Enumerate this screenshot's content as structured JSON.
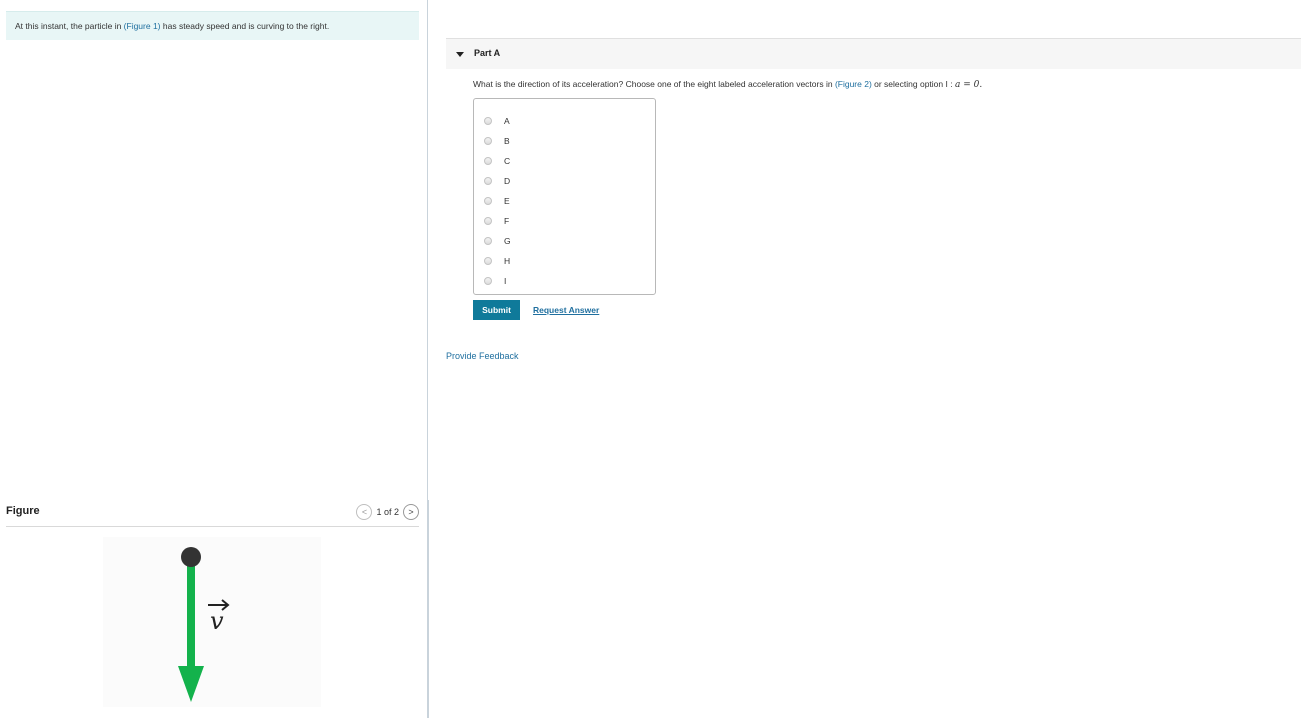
{
  "intro": {
    "before": "At this instant, the particle in ",
    "link": "(Figure 1)",
    "after": " has steady speed and is curving to the right."
  },
  "figure": {
    "title": "Figure",
    "pager": "1 of 2",
    "prev_icon": "<",
    "next_icon": ">",
    "vector_label": "v",
    "colors": {
      "arrow": "#13b24c",
      "particle": "#333333"
    }
  },
  "part": {
    "title": "Part A",
    "question_before": "What is the direction of its acceleration? Choose one of the eight labeled acceleration vectors in ",
    "question_link": "(Figure 2)",
    "question_after": " or selecting option I : ",
    "math_lhs": "a",
    "math_eq": " = ",
    "math_rhs": "0",
    "math_end": ".",
    "options": [
      "A",
      "B",
      "C",
      "D",
      "E",
      "F",
      "G",
      "H",
      "I"
    ],
    "submit": "Submit",
    "request_answer": "Request Answer"
  },
  "feedback": "Provide Feedback",
  "colors": {
    "accent": "#0f7a9a",
    "link": "#1f6f9f",
    "intro_bg": "#e8f6f6"
  }
}
